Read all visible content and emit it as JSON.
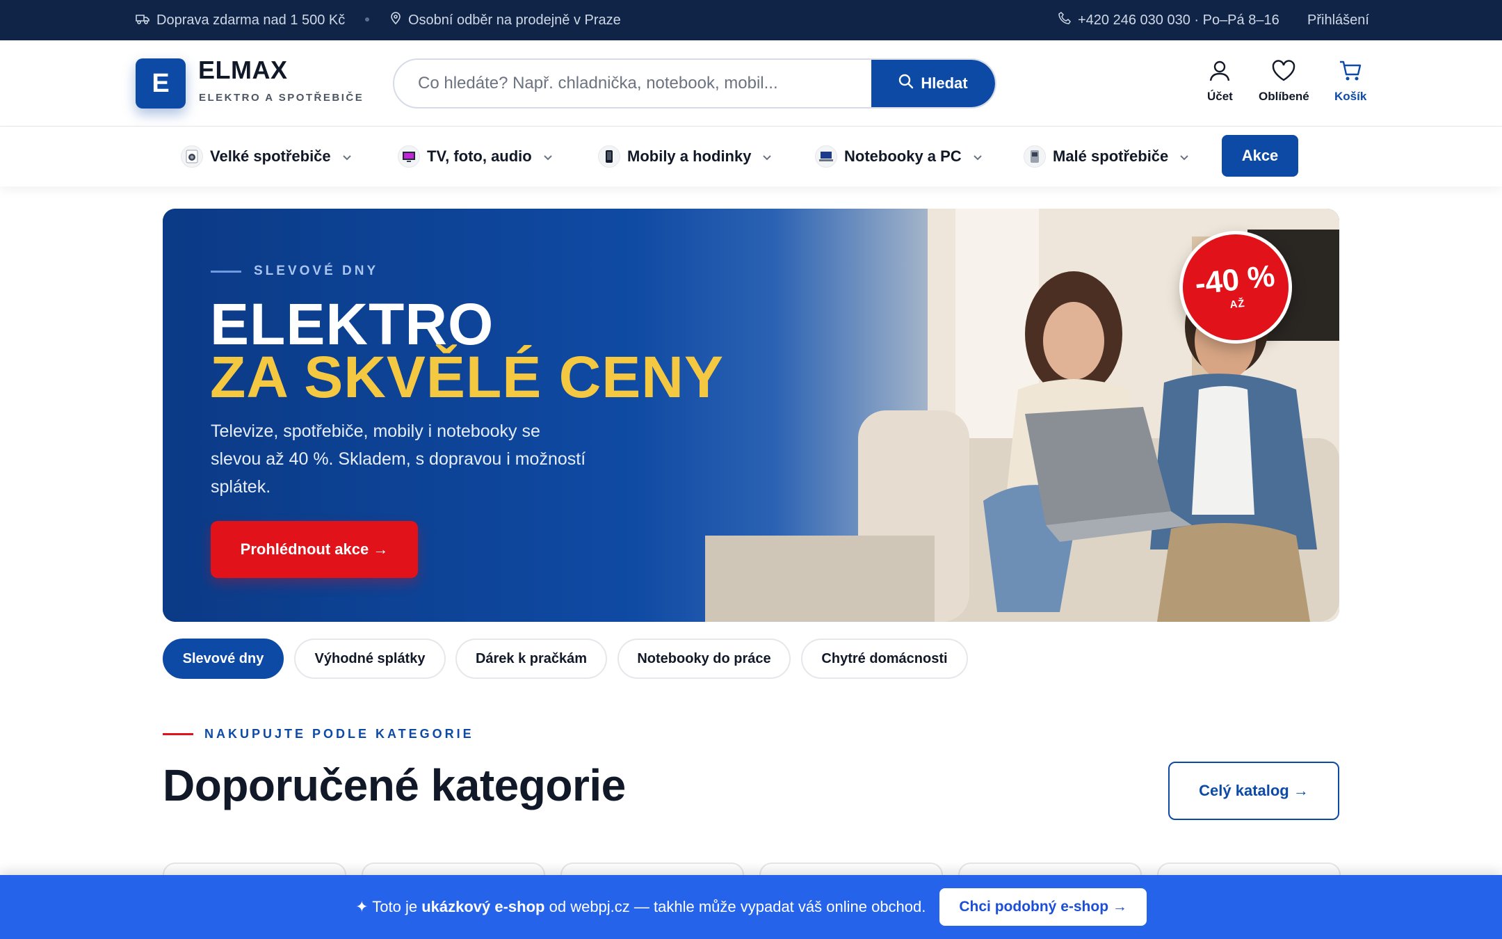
{
  "topbar": {
    "shipping": "Doprava zdarma nad 1 500 Kč",
    "pickup": "Osobní odběr na prodejně v Praze",
    "phone": "+420 246 030 030 · Po–Pá 8–16",
    "login": "Přihlášení"
  },
  "header": {
    "logo_letter": "E",
    "logo_name": "ELMAX",
    "logo_tagline": "ELEKTRO A SPOTŘEBIČE",
    "search_placeholder": "Co hledáte? Např. chladnička, notebook, mobil...",
    "search_button": "Hledat",
    "account": "Účet",
    "favorites": "Oblíbené",
    "cart": "Košík"
  },
  "nav": {
    "categories": [
      {
        "label": "Velké spotřebiče",
        "icon": "washer-icon"
      },
      {
        "label": "TV, foto, audio",
        "icon": "tv-icon"
      },
      {
        "label": "Mobily a hodinky",
        "icon": "phone-icon"
      },
      {
        "label": "Notebooky a PC",
        "icon": "laptop-icon"
      },
      {
        "label": "Malé spotřebiče",
        "icon": "appliance-icon"
      }
    ],
    "akce": "Akce"
  },
  "hero": {
    "eyebrow": "SLEVOVÉ DNY",
    "title_line1": "ELEKTRO",
    "title_line2": "ZA SKVĚLÉ CENY",
    "text": "Televize, spotřebiče, mobily i notebooky se slevou až 40 %. Skladem, s dopravou i možností splátek.",
    "cta": "Prohlédnout akce →",
    "badge_value": "-40 %",
    "badge_sub": "AŽ"
  },
  "pills": [
    "Slevové dny",
    "Výhodné splátky",
    "Dárek k pračkám",
    "Notebooky do práce",
    "Chytré domácnosti"
  ],
  "section": {
    "eyebrow": "NAKUPUJTE PODLE KATEGORIE",
    "title": "Doporučené kategorie",
    "catalog_button": "Celý katalog →"
  },
  "promo": {
    "prefix": "✦ Toto je",
    "bold": "ukázkový e-shop",
    "suffix": "od webpj.cz — takhle může vypadat váš online obchod.",
    "button": "Chci podobný e-shop →"
  },
  "colors": {
    "brand": "#0d4aa6",
    "topbar": "#0f2447",
    "accent_red": "#e1121a",
    "accent_yellow": "#f5c842",
    "promo": "#2563eb"
  }
}
